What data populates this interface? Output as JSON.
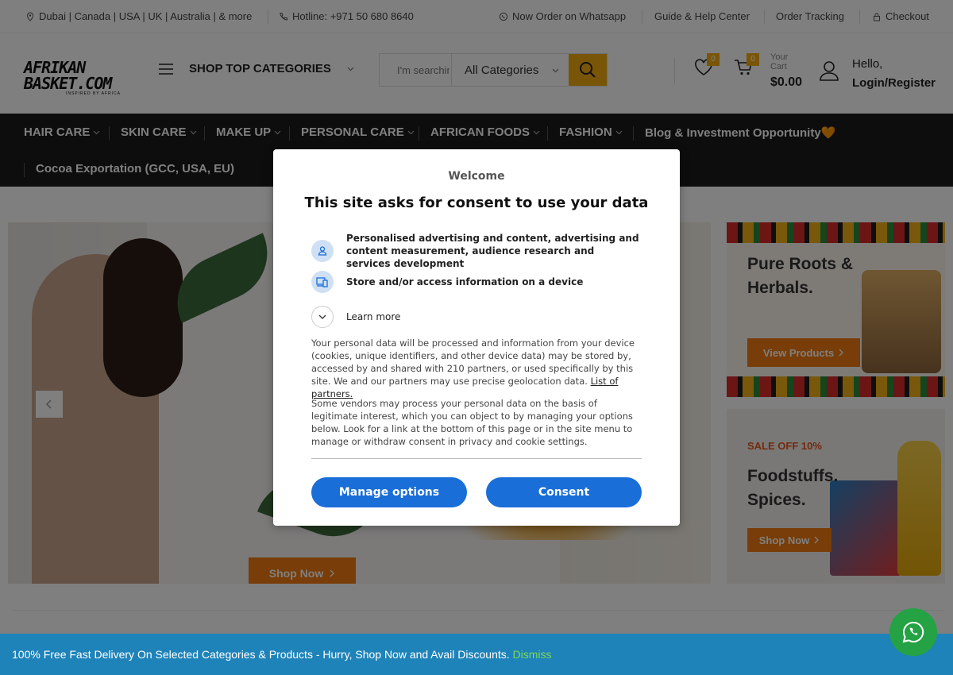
{
  "topbar": {
    "locations": "Dubai | Canada | USA | UK | Australia | & more",
    "hotline": "Hotline: +971 50 680 8640",
    "whatsapp": "Now Order on Whatsapp",
    "guide": "Guide & Help Center",
    "tracking": "Order Tracking",
    "checkout": "Checkout"
  },
  "header": {
    "logo_line1": "AFRIKAN",
    "logo_line2": "BASKET.COM",
    "logo_tagline": "INSPIRED BY AFRICA",
    "categories_label": "SHOP TOP CATEGORIES",
    "search_placeholder": "I'm searching for...",
    "search_category": "All Categories",
    "wishlist_count": "0",
    "cart_count": "0",
    "cart_label": "Your Cart",
    "cart_total": "$0.00",
    "greeting": "Hello,",
    "login_label": "Login/Register"
  },
  "nav": {
    "items": [
      "HAIR CARE",
      "SKIN CARE",
      "MAKE UP",
      "PERSONAL CARE",
      "AFRICAN FOODS",
      "FASHION"
    ],
    "blog": "Blog & Investment Opportunity🧡",
    "cocoa": "Cocoa Exportation (GCC, USA, EU)"
  },
  "hero": {
    "shop_now": "Shop Now"
  },
  "side_banners": {
    "first_title": "Pure Roots & Herbals.",
    "first_button": "View Products",
    "second_sale": "SALE OFF 10%",
    "second_title": "Foodstuffs. Spices.",
    "second_button": "Shop Now"
  },
  "consent": {
    "welcome": "Welcome",
    "headline": "This site asks for consent to use your data",
    "purpose1": "Personalised advertising and content, advertising and content measurement, audience research and services development",
    "purpose2": "Store and/or access information on a device",
    "learn_more": "Learn more",
    "paragraph1": "Your personal data will be processed and information from your device (cookies, unique identifiers, and other device data) may be stored by, accessed by and shared with 210 partners, or used specifically by this site. We and our partners may use precise geolocation data.",
    "partners_link": "List of partners.",
    "paragraph2": "Some vendors may process your personal data on the basis of legitimate interest, which you can object to by managing your options below. Look for a link at the bottom of this page or in the site menu to manage or withdraw consent in privacy and cookie settings.",
    "manage_button": "Manage options",
    "consent_button": "Consent"
  },
  "banner": {
    "text": "100% Free Fast Delivery On Selected Categories & Products - Hurry, Shop Now and Avail Discounts.",
    "dismiss": "Dismiss"
  },
  "colors": {
    "accent": "#f2ab10",
    "orange_button": "#f07a10",
    "nav_bg": "#1b1b1b",
    "consent_blue": "#1a6ed8",
    "banner_blue": "#1e83b9",
    "whatsapp_green": "#25a244"
  }
}
